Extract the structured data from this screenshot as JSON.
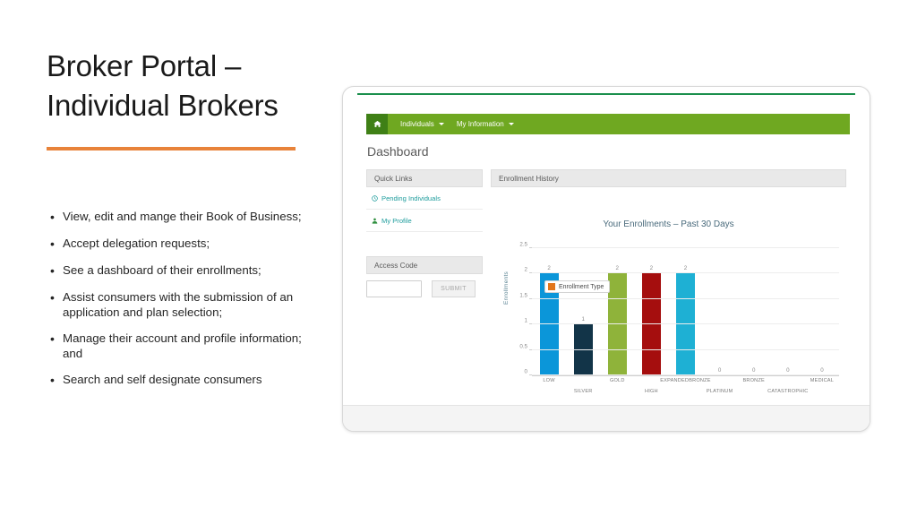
{
  "slide": {
    "title": "Broker Portal – Individual Brokers",
    "bullet_marker": "•",
    "bullets": [
      "View, edit and mange their Book of Business;",
      "Accept delegation requests;",
      "See a dashboard of their enrollments;",
      "Assist consumers with the submission of an application and plan selection;",
      "Manage their account and profile information; and",
      "Search and self designate consumers"
    ],
    "accent_color": "#e8833a"
  },
  "portal": {
    "navbar": {
      "home_icon": "home-icon",
      "background_color": "#6fa821",
      "items": [
        {
          "label": "Individuals",
          "caret": "▾"
        },
        {
          "label": "My Information",
          "caret": "▾"
        }
      ]
    },
    "page_title": "Dashboard",
    "quick_links": {
      "header": "Quick Links",
      "items": [
        {
          "label": "Pending Individuals",
          "icon": "clock-icon",
          "icon_color": "#1f9d9d"
        },
        {
          "label": "My Profile",
          "icon": "user-icon",
          "icon_color": "#2f8f3f"
        }
      ]
    },
    "access_code": {
      "header": "Access Code",
      "input_value": "",
      "input_placeholder": "",
      "submit_label": "SUBMIT"
    },
    "enrollment_history": {
      "header": "Enrollment History"
    }
  },
  "chart_data": {
    "type": "bar",
    "title": "Your Enrollments – Past 30 Days",
    "xlabel": "",
    "ylabel": "Enrollments",
    "ylim": [
      0,
      2.5
    ],
    "yticks": [
      0,
      0.5,
      1,
      1.5,
      2,
      2.5
    ],
    "ytick_labels": [
      "0",
      "0.5",
      "1",
      "1.5",
      "2",
      "2.5"
    ],
    "grid": true,
    "legend": {
      "position": "inside-top-left",
      "entries": [
        {
          "label": "Enrollment Type",
          "color": "#e2761c"
        }
      ]
    },
    "categories": [
      "LOW",
      "SILVER",
      "GOLD",
      "HIGH",
      "EXPANDEDBRONZE",
      "PLATINUM",
      "BRONZE",
      "CATASTROPHIC",
      "MEDICAL"
    ],
    "values": [
      2,
      1,
      2,
      2,
      2,
      0,
      0,
      0,
      0
    ],
    "value_labels": [
      "2",
      "1",
      "2",
      "2",
      "2",
      "0",
      "0",
      "0",
      "0"
    ],
    "bar_colors": [
      "#0b96d9",
      "#123448",
      "#8fb33a",
      "#a50e0e",
      "#1eb0d4",
      "#ffffff",
      "#ffffff",
      "#ffffff",
      "#ffffff"
    ],
    "label_rows": [
      0,
      1,
      0,
      1,
      0,
      1,
      0,
      1,
      0
    ]
  }
}
